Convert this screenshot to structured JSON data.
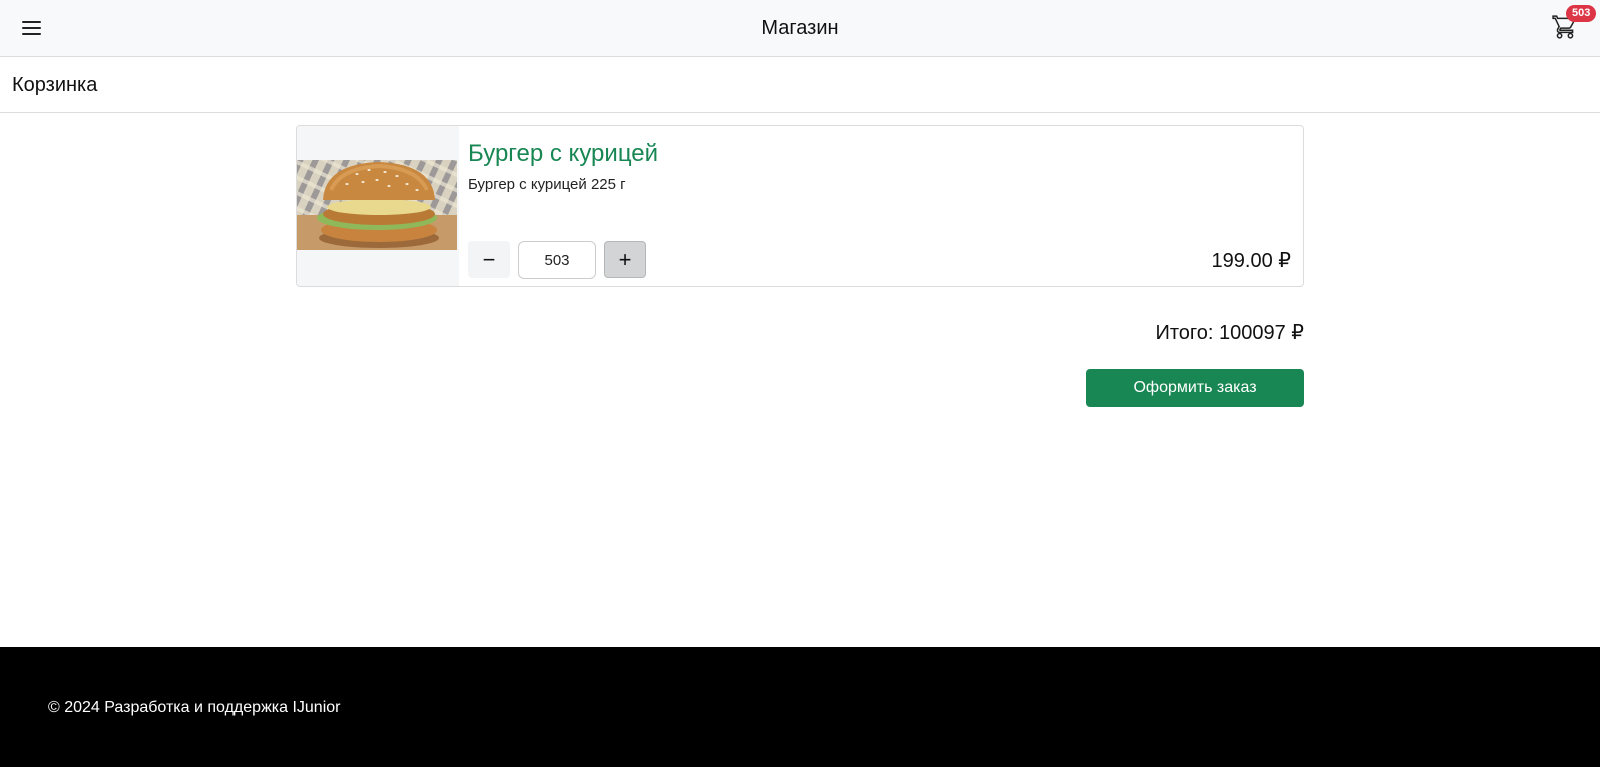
{
  "header": {
    "title": "Магазин",
    "menu_icon": "hamburger-menu-icon",
    "cart_icon": "shopping-cart-icon",
    "cart_count": "503",
    "badge_color": "#dc3545"
  },
  "page": {
    "title": "Корзинка"
  },
  "cart": {
    "items": [
      {
        "name": "Бургер с курицей",
        "description": "Бургер с курицей 225 г",
        "image": "chicken-burger-photo",
        "quantity": "503",
        "minus_label": "−",
        "plus_label": "+",
        "price": "199.00 ₽"
      }
    ],
    "total": "Итого: 100097 ₽",
    "checkout_label": "Оформить заказ"
  },
  "footer": {
    "text": "© 2024 Разработка и поддержка IJunior"
  },
  "colors": {
    "accent": "#198754",
    "footer_bg": "#000000",
    "topbar_bg": "#f8f9fa"
  }
}
